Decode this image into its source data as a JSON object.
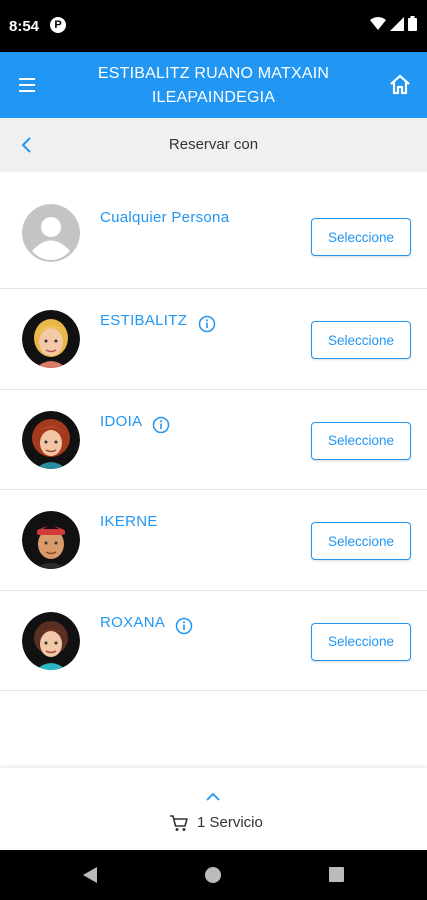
{
  "status_bar": {
    "time": "8:54",
    "app_icon": "P"
  },
  "header": {
    "title_line1": "ESTIBALITZ RUANO MATXAIN",
    "title_line2": "ILEAPAINDEGIA",
    "menu_icon": "menu-icon",
    "home_icon": "home-icon"
  },
  "subheader": {
    "title": "Reservar con",
    "back_icon": "chevron-left-icon"
  },
  "staff": [
    {
      "name": "Cualquier Persona",
      "button": "Seleccione",
      "has_info": false
    },
    {
      "name": "ESTIBALITZ",
      "button": "Seleccione",
      "has_info": true
    },
    {
      "name": "IDOIA",
      "button": "Seleccione",
      "has_info": true
    },
    {
      "name": "IKERNE",
      "button": "Seleccione",
      "has_info": false
    },
    {
      "name": "ROXANA",
      "button": "Seleccione",
      "has_info": true
    }
  ],
  "footer": {
    "cart_label": "1 Servicio",
    "expand_icon": "chevron-up-icon",
    "cart_icon": "cart-icon"
  },
  "colors": {
    "accent": "#2196f3",
    "subheader_bg": "#f0f0f0"
  }
}
